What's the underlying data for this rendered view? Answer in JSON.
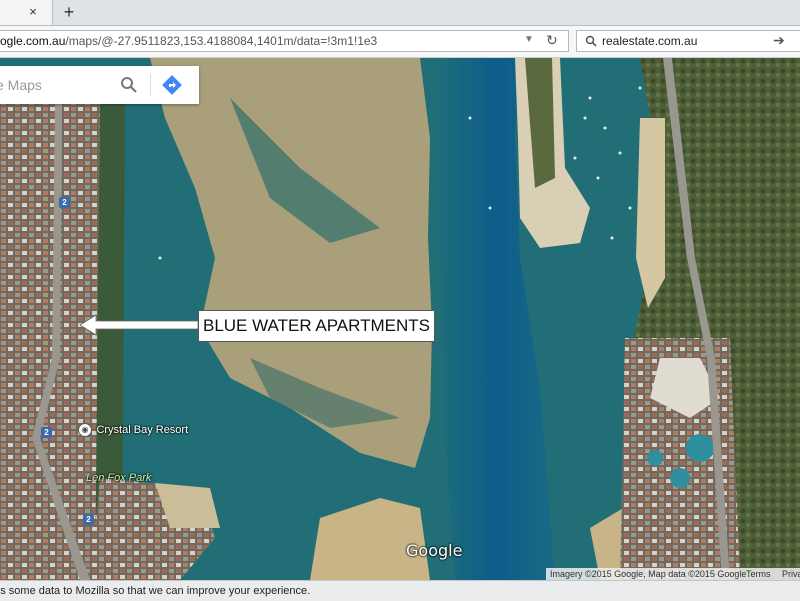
{
  "tab": {
    "close_glyph": "×",
    "new_tab_glyph": "+"
  },
  "navbar": {
    "url_host": "ogle.com.au",
    "url_path": "/maps/@-27.9511823,153.4188084,1401m/data=!3m1!1e3",
    "search_engine_text": "realestate.com.au"
  },
  "map": {
    "search_placeholder": "e Maps",
    "annotation_text": "BLUE WATER APARTMENTS",
    "poi_label": "Crystal Bay Resort",
    "park_label": "Len Fox Park",
    "road_shield": "2",
    "logo_text": "Google",
    "attribution": "Imagery ©2015 Google, Map data ©2015 Google",
    "terms_label": "Terms",
    "privacy_label": "Privacy"
  },
  "notification": {
    "text": "nds some data to Mozilla so that we can improve your experience."
  },
  "colors": {
    "water": "#1f6f79",
    "deep_channel": "#0f5f88",
    "sand": "#c2ac82",
    "land_green": "#4d5e36",
    "urban": "#7a6b60"
  },
  "icons": [
    "close-icon",
    "plus-icon",
    "dropdown-arrow-icon",
    "reload-icon",
    "search-icon",
    "arrow-right-icon",
    "directions-icon",
    "poi-icon",
    "road-shield-icon"
  ]
}
